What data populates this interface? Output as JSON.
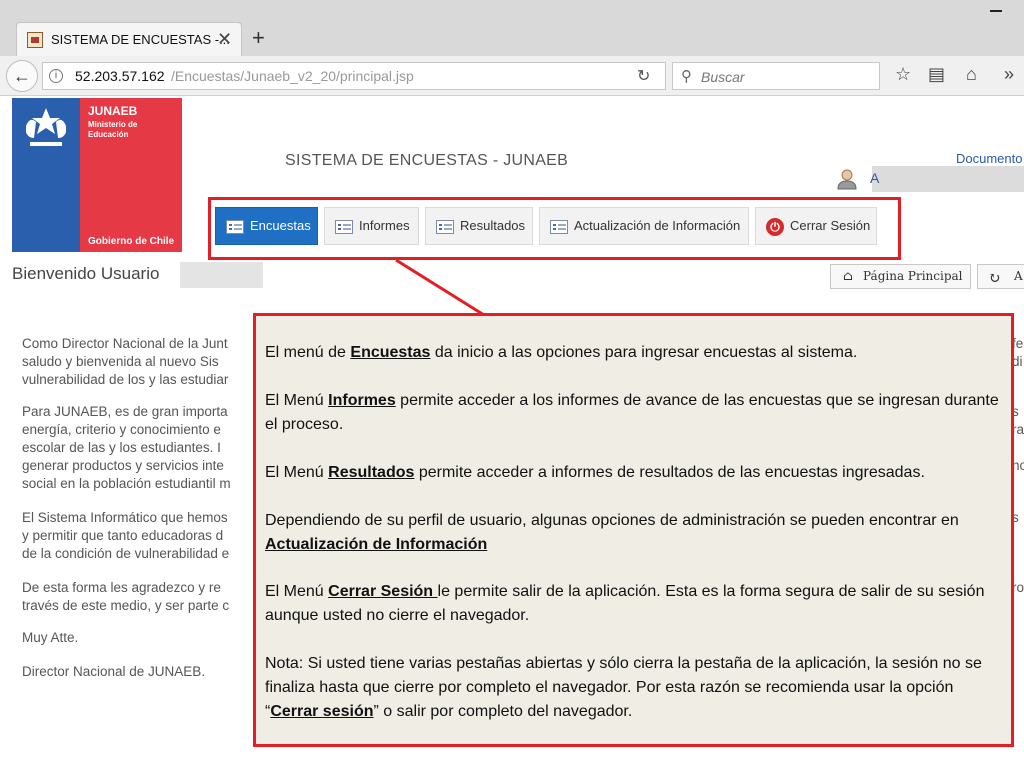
{
  "browser": {
    "tab_title": "SISTEMA DE ENCUESTAS -...",
    "url_host": "52.203.57.162",
    "url_path": "/Encuestas/Junaeb_v2_20/principal.jsp",
    "search_placeholder": "Buscar"
  },
  "logo": {
    "name": "JUNAEB",
    "subtitle": "Ministerio de Educación",
    "government": "Gobierno de Chile",
    "colors": {
      "blue": "#2a5fae",
      "red": "#e63946"
    }
  },
  "header": {
    "system_title": "SISTEMA DE ENCUESTAS - JUNAEB",
    "documents_link": "Documento",
    "user_initial": "A"
  },
  "menu": {
    "items": [
      {
        "label": "Encuestas",
        "icon": "list-icon",
        "active": true
      },
      {
        "label": "Informes",
        "icon": "list-icon",
        "active": false
      },
      {
        "label": "Resultados",
        "icon": "list-icon",
        "active": false
      },
      {
        "label": "Actualización de Información",
        "icon": "list-icon",
        "active": false
      },
      {
        "label": "Cerrar Sesión",
        "icon": "power-icon",
        "active": false
      }
    ]
  },
  "welcome": "Bienvenido Usuario",
  "buttons": {
    "home": "Página  Principal",
    "refresh": "A"
  },
  "body_lines": [
    "Como Director Nacional de la Junt",
    "saludo y bienvenida al nuevo Sis",
    "vulnerabilidad de los y las estudiar",
    "Para JUNAEB, es de gran importa",
    "energía, criterio y conocimiento e",
    "escolar de las y los estudiantes. I",
    "generar productos y servicios inte",
    "social en la población estudiantil m",
    "El Sistema Informático que hemos",
    "y permitir que tanto educadoras d",
    "de la condición de vulnerabilidad e",
    "De esta forma les agradezco y re",
    "través de este medio, y ser parte c",
    "Muy Atte.",
    "Director Nacional de JUNAEB."
  ],
  "right_fragments": [
    "fe",
    "di",
    "s",
    "ra",
    "no",
    "s",
    "ros"
  ],
  "callout": {
    "p1": {
      "pre": "El menú de ",
      "key": "Encuestas",
      "post": " da inicio a las opciones para ingresar encuestas al sistema."
    },
    "p2": {
      "pre": "El Menú ",
      "key": "Informes",
      "post": " permite acceder a los informes de avance de las encuestas que se ingresan durante el proceso."
    },
    "p3": {
      "pre": "El Menú ",
      "key": "Resultados",
      "post": " permite acceder a informes de resultados de las encuestas ingresadas."
    },
    "p4": {
      "pre": "Dependiendo de su perfil de usuario, algunas opciones de administración se pueden encontrar en ",
      "key": "Actualización de Información",
      "post": ""
    },
    "p5": {
      "pre": "El Menú ",
      "key": "Cerrar Sesión ",
      "post": "le permite salir de la aplicación. Esta es la forma segura de salir de su sesión  aunque usted no cierre el navegador."
    },
    "p6": {
      "pre": "Nota: Si usted tiene varias pestañas abiertas y sólo cierra la pestaña de la aplicación, la sesión no se finaliza  hasta que cierre por completo el navegador. Por esta razón se recomienda usar la opción “",
      "key": "Cerrar sesión",
      "post": "” o salir por completo del navegador."
    }
  }
}
